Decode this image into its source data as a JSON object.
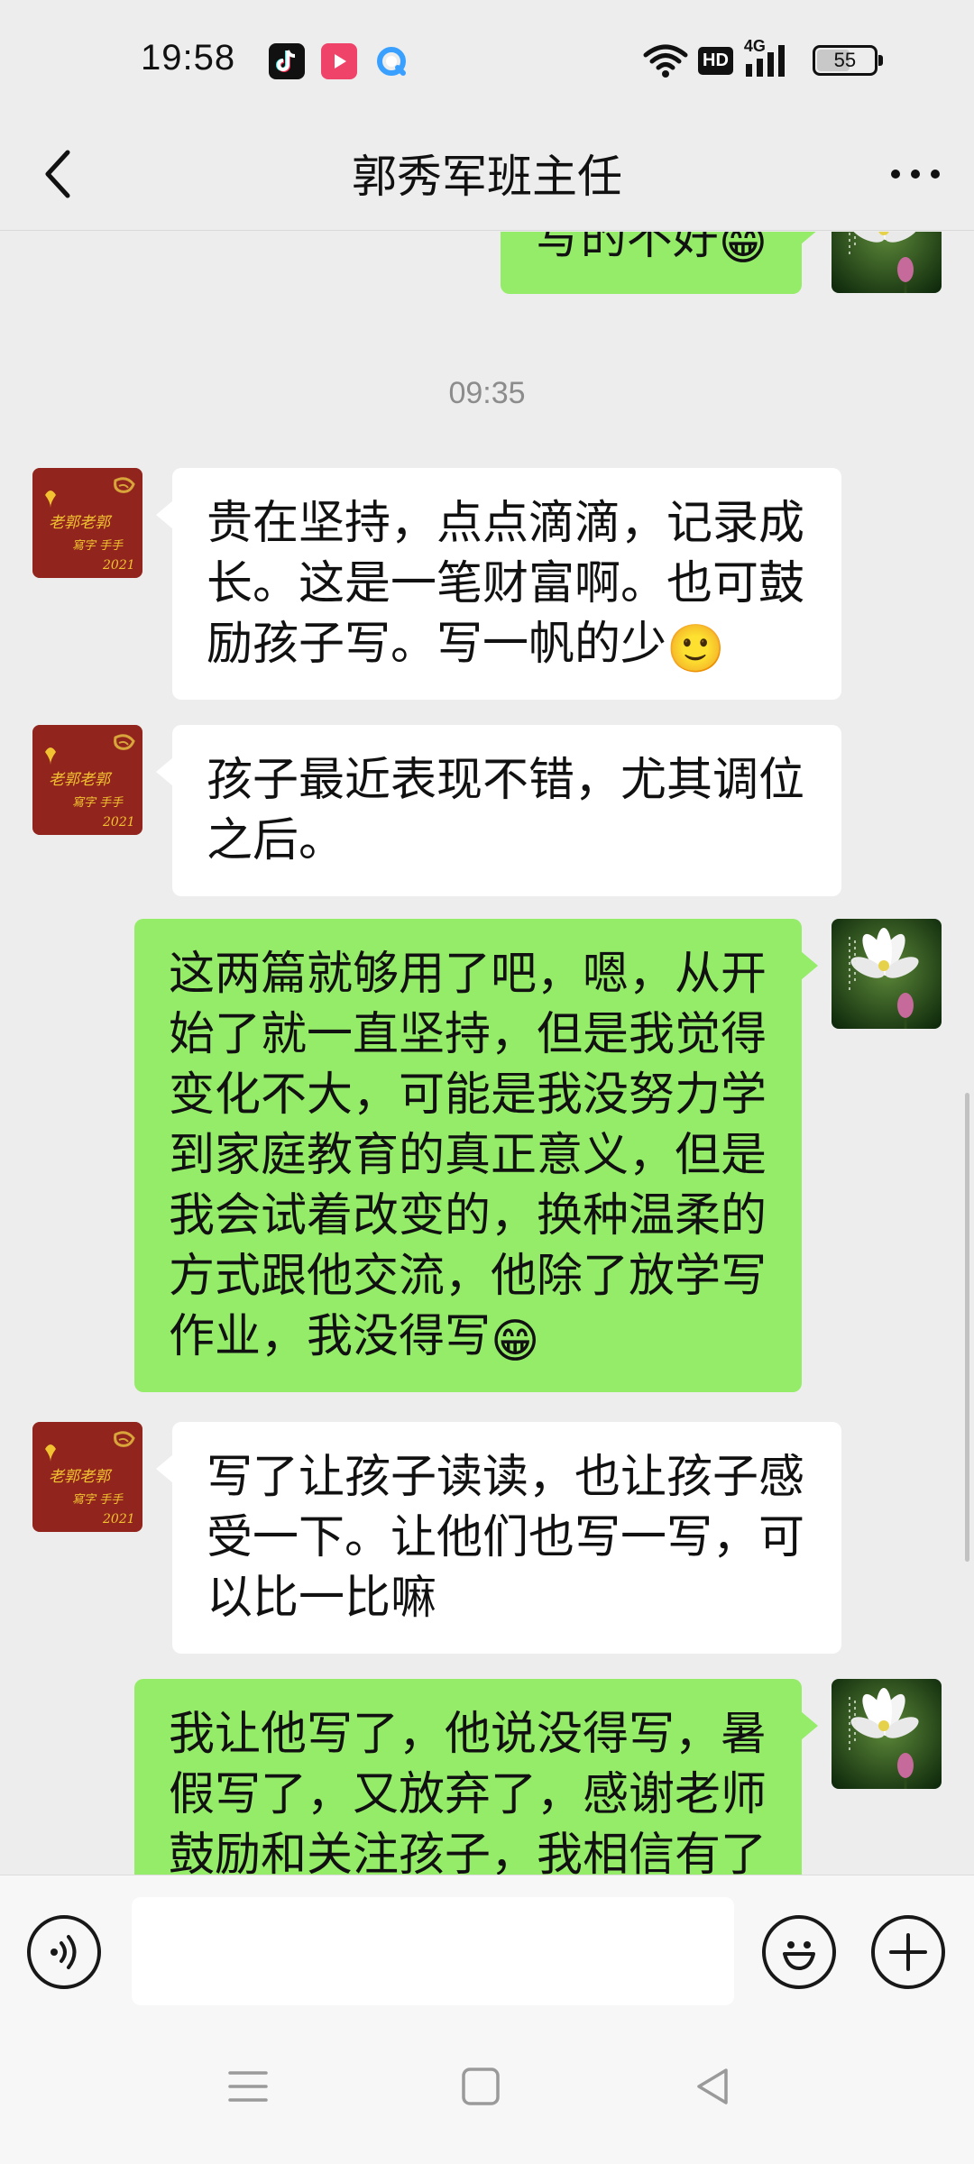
{
  "status_bar": {
    "time": "19:58",
    "network": "4G",
    "hd": "HD",
    "battery": "55",
    "app_icons": [
      "tiktok-icon",
      "video-app-icon",
      "browser-app-icon"
    ]
  },
  "nav": {
    "title": "郭秀军班主任"
  },
  "timestamp": "09:35",
  "messages": [
    {
      "side": "out",
      "text": "写的不好",
      "emoji": "😁"
    },
    {
      "side": "in",
      "text": "贵在坚持，点点滴滴，记录成长。这是一笔财富啊。也可鼓励孩子写。写一帆的少",
      "emoji": "🙂"
    },
    {
      "side": "in",
      "text": "孩子最近表现不错，尤其调位之后。",
      "emoji": ""
    },
    {
      "side": "out",
      "text": "这两篇就够用了吧，嗯，从开始了就一直坚持，但是我觉得变化不大，可能是我没努力学到家庭教育的真正意义，但是我会试着改变的，换种温柔的方式跟他交流，他除了放学写作业，我没得写",
      "emoji": "😁"
    },
    {
      "side": "in",
      "text": "写了让孩子读读，也让孩子感受一下。让他们也写一写，可以比一比嘛",
      "emoji": ""
    },
    {
      "side": "out",
      "text": "我让他写了，他说没得写，暑假写了，又放弃了，感谢老师鼓励和关注孩子，我相信有了",
      "emoji": ""
    }
  ],
  "avatars": {
    "contact_text": "老郭老郭 寫字 手手 2021",
    "self_text": "清 心 自 在"
  },
  "input": {
    "value": "",
    "placeholder": ""
  },
  "colors": {
    "background": "#ededed",
    "outgoing_bubble": "#95ec69",
    "incoming_bubble": "#ffffff",
    "contact_avatar": "#9c2a22"
  }
}
